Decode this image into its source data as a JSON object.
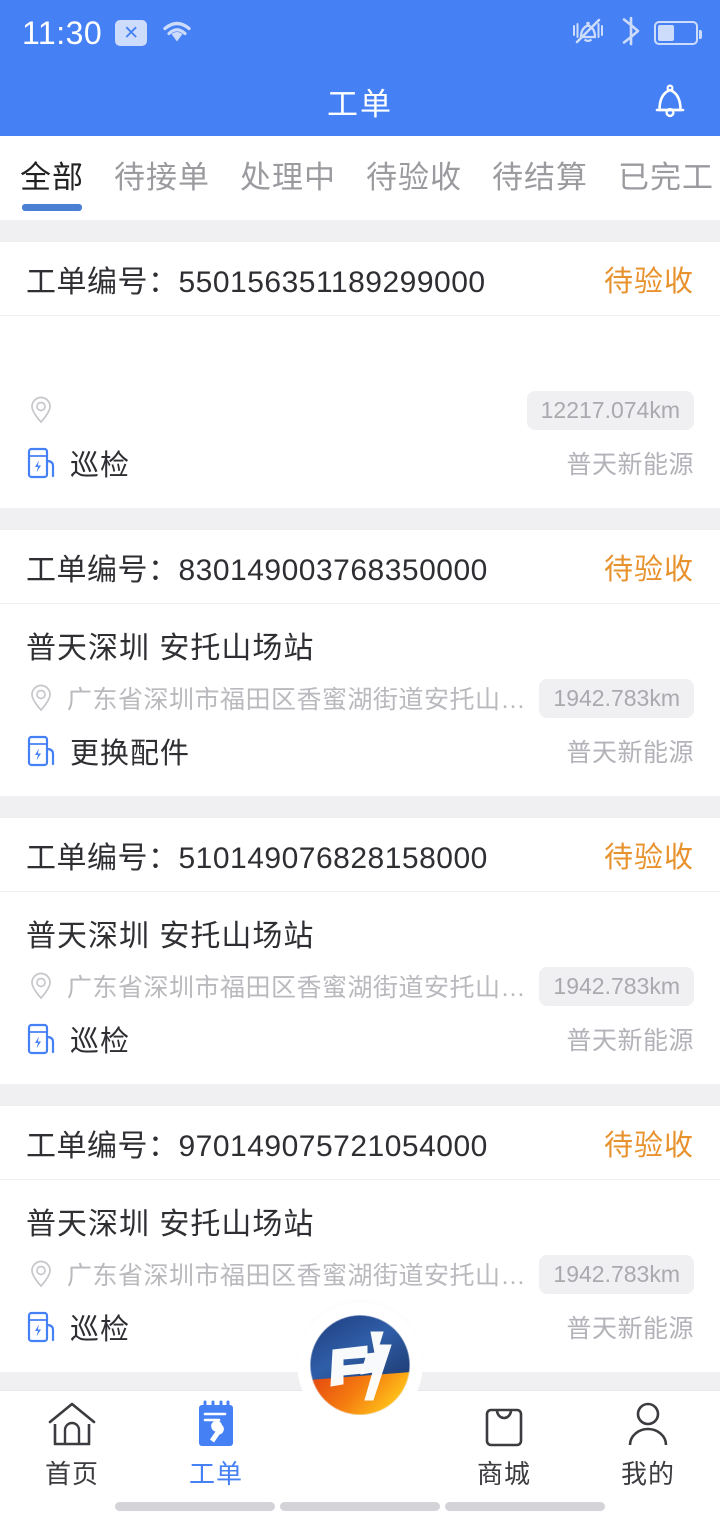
{
  "status_bar": {
    "time": "11:30",
    "sim_badge_label": "✕",
    "icons": [
      "no-sim-icon",
      "wifi-icon",
      "silent-mode-icon",
      "bluetooth-icon",
      "battery-icon"
    ],
    "battery_level_pct": 45,
    "background_color": "#4580f5"
  },
  "app_bar": {
    "title": "工单",
    "notification_icon": "bell-icon",
    "background_color": "#4580f5",
    "title_color": "#ffffff"
  },
  "tabs": {
    "active_index": 0,
    "active_color": "#4a7fd4",
    "inactive_color": "#9a9a9f",
    "items": [
      {
        "label": "全部"
      },
      {
        "label": "待接单"
      },
      {
        "label": "处理中"
      },
      {
        "label": "待验收"
      },
      {
        "label": "待结算"
      },
      {
        "label": "已完工"
      }
    ]
  },
  "list": {
    "order_no_label": "工单编号：",
    "status_color": "#e8922e",
    "orders": [
      {
        "order_no": "550156351189299000",
        "status": "待验收",
        "station": "",
        "address": "",
        "distance": "12217.074km",
        "work_type": "巡检",
        "company": "普天新能源"
      },
      {
        "order_no": "830149003768350000",
        "status": "待验收",
        "station": "普天深圳 安托山场站",
        "address": "广东省深圳市福田区香蜜湖街道安托山大…",
        "distance": "1942.783km",
        "work_type": "更换配件",
        "company": "普天新能源"
      },
      {
        "order_no": "510149076828158000",
        "status": "待验收",
        "station": "普天深圳 安托山场站",
        "address": "广东省深圳市福田区香蜜湖街道安托山大…",
        "distance": "1942.783km",
        "work_type": "巡检",
        "company": "普天新能源"
      },
      {
        "order_no": "970149075721054000",
        "status": "待验收",
        "station": "普天深圳 安托山场站",
        "address": "广东省深圳市福田区香蜜湖街道安托山大…",
        "distance": "1942.783km",
        "work_type": "巡检",
        "company": "普天新能源"
      }
    ]
  },
  "tabbar": {
    "active_index": 1,
    "active_color": "#4580f5",
    "items": [
      {
        "label": "首页",
        "icon": "home-icon"
      },
      {
        "label": "工单",
        "icon": "clipboard-wrench-icon"
      },
      {
        "label": "商城",
        "icon": "shopping-bag-icon"
      },
      {
        "label": "我的",
        "icon": "person-icon"
      }
    ],
    "center_button": {
      "icon": "brand-logo-icon"
    }
  }
}
